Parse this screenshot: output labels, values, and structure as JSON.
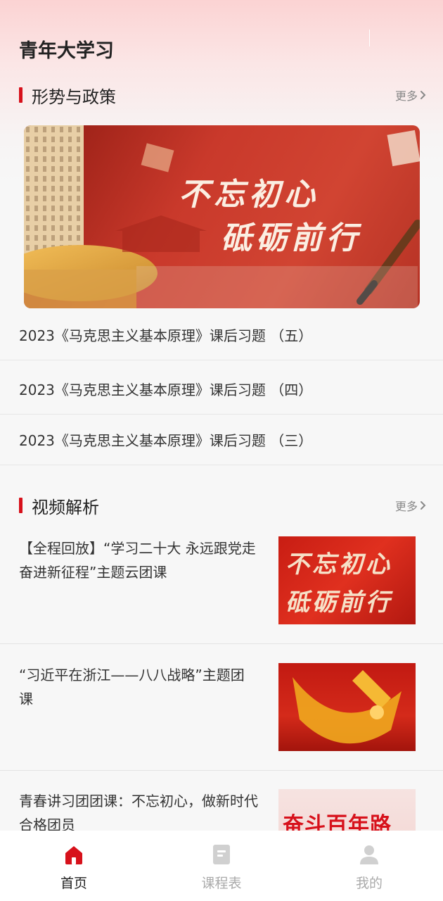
{
  "header": {
    "title": "青年大学习"
  },
  "policy_section": {
    "title": "形势与政策",
    "more_label": "更多",
    "banner_text_line1": "不忘初心",
    "banner_text_line2": "砥砺前行",
    "articles": [
      {
        "title": "2023《马克思主义基本原理》课后习题 （五）"
      },
      {
        "title": "2023《马克思主义基本原理》课后习题 （四）"
      },
      {
        "title": "2023《马克思主义基本原理》课后习题 （三）"
      }
    ]
  },
  "video_section": {
    "title": "视频解析",
    "more_label": "更多",
    "items": [
      {
        "title": "【全程回放】“学习二十大 永远跟党走 奋进新征程”主题云团课",
        "thumb_line1": "不忘初心",
        "thumb_line2": "砥砺前行"
      },
      {
        "title": "“习近平在浙江——八八战略”主题团课"
      },
      {
        "title": "青春讲习团团课：不忘初心，做新时代合格团员",
        "thumb_text": "奋斗百年路"
      }
    ]
  },
  "tabbar": {
    "tabs": [
      {
        "label": "首页",
        "icon": "home-icon",
        "active": true
      },
      {
        "label": "课程表",
        "icon": "book-icon",
        "active": false
      },
      {
        "label": "我的",
        "icon": "person-icon",
        "active": false
      }
    ],
    "active_color": "#d7111b",
    "inactive_color": "#cccccc"
  },
  "colors": {
    "accent": "#d7111b",
    "background": "#f7f7f7"
  }
}
